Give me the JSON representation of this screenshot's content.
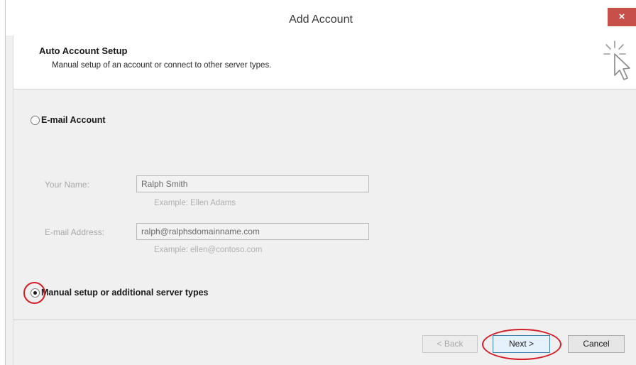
{
  "window": {
    "title": "Add Account",
    "close_glyph": "×"
  },
  "header": {
    "title": "Auto Account Setup",
    "subtitle": "Manual setup of an account or connect to other server types.",
    "icon": "cursor-click-icon"
  },
  "options": {
    "email_account": {
      "label": "E-mail Account",
      "selected": false
    },
    "manual_setup": {
      "label": "Manual setup or additional server types",
      "selected": true
    }
  },
  "fields": {
    "name": {
      "label": "Your Name:",
      "value": "Ralph Smith",
      "example": "Example: Ellen Adams"
    },
    "email": {
      "label": "E-mail Address:",
      "value": "ralph@ralphsdomainname.com",
      "example": "Example: ellen@contoso.com"
    }
  },
  "buttons": {
    "back": "< Back",
    "next": "Next >",
    "cancel": "Cancel"
  },
  "colors": {
    "annotation": "#d41e28",
    "close_button": "#c7504b"
  }
}
